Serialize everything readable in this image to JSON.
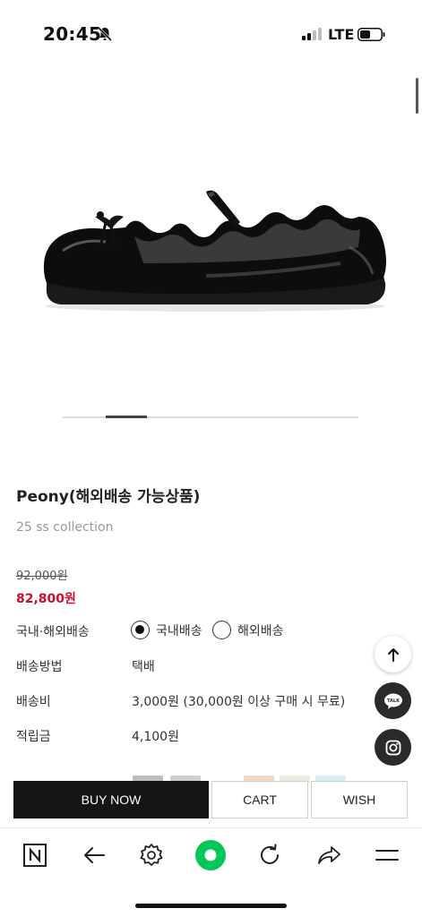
{
  "status_bar": {
    "time": "20:45",
    "network": "LTE"
  },
  "product": {
    "title": "Peony(해외배송 가능상품)",
    "collection": "25 ss collection",
    "original_price": "92,000원",
    "sale_price": "82,800원"
  },
  "details": {
    "shipping_type": {
      "label": "국내·해외배송",
      "options": [
        "국내배송",
        "해외배송"
      ],
      "selected": "국내배송"
    },
    "shipping_method": {
      "label": "배송방법",
      "value": "택배"
    },
    "shipping_fee": {
      "label": "배송비",
      "value": "3,000원 (30,000원 이상 구매 시 무료)"
    },
    "points": {
      "label": "적립금",
      "value": "4,100원"
    }
  },
  "actions": {
    "buy_now": "BUY NOW",
    "cart": "CART",
    "wish": "WISH"
  },
  "floating_buttons": {
    "kakao_label": "TALK"
  },
  "icons": [
    "bell-muted-icon",
    "signal-icon",
    "battery-icon",
    "scroll-top-icon",
    "kakaotalk-icon",
    "instagram-icon",
    "naver-home-icon",
    "back-arrow-icon",
    "settings-icon",
    "green-dot-icon",
    "refresh-icon",
    "share-icon",
    "menu-icon"
  ],
  "colors": {
    "sale_price": "#c8102e",
    "buy_button": "#151515",
    "naver_green": "#03c75a"
  }
}
